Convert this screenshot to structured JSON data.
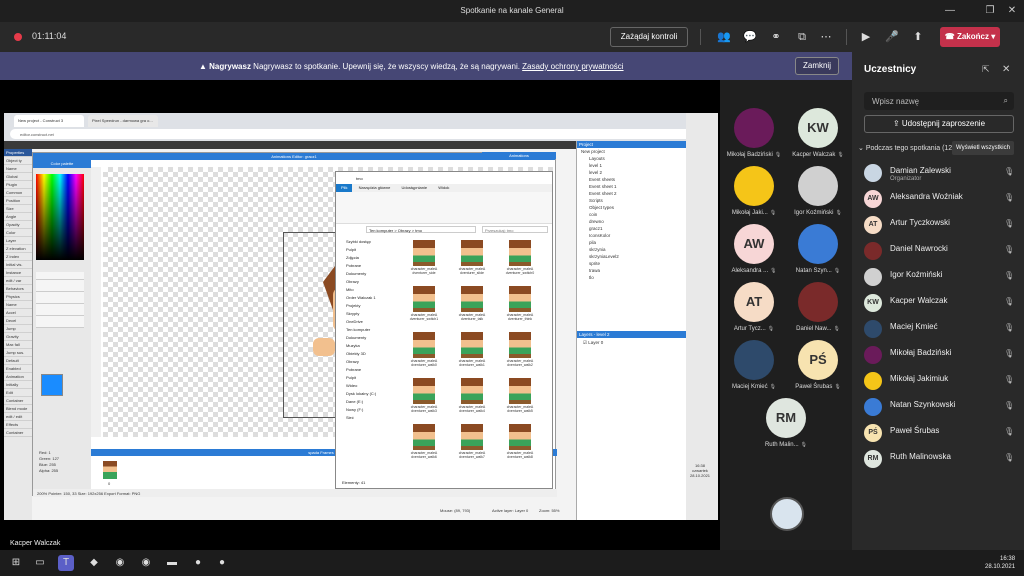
{
  "window": {
    "title": "Spotkanie na kanale General"
  },
  "toolbar": {
    "timer": "01:11:04",
    "control_label": "Zażądaj kontroli",
    "end_label": "Zakończ"
  },
  "banner": {
    "bold": "Nagrywasz",
    "text": " Nagrywasz to spotkanie. Upewnij się, że wszyscy wiedzą, że są nagrywani. ",
    "link": "Zasady ochrony prywatności",
    "close_label": "Zamknij"
  },
  "shared": {
    "presenter": "Kacper Walczak",
    "browser_tabs": [
      "New project - Construct 3",
      "Pixel Speedrun - darmowa gra o..."
    ],
    "url": "editor.construct.net",
    "properties": [
      "Properties",
      "Object ty",
      "Name",
      "Global",
      "Plugin",
      "Common",
      "Position",
      "Size",
      "Angle",
      "Opacity",
      "Color",
      "Layer",
      "Z elevation",
      "Z index",
      "Initial vis.",
      "Instance",
      "edit / var",
      "Behaviors",
      "Physics",
      "Name",
      "Accel",
      "Decel",
      "Jump",
      "Gravity",
      "Max fall",
      "Jump sus.",
      "Default",
      "Enabled",
      "Animation",
      "Initially",
      "Edit",
      "Container",
      "Blend mode",
      "edit / edit",
      "Effects",
      "Container"
    ],
    "anim_editor_title": "Animations Editor: gracz1",
    "animations_title": "Animations",
    "palette_title": "Color palette",
    "rgba": {
      "red": "Red: 1",
      "green": "Green: 127",
      "blue": "Blue: 255",
      "alpha": "Alpha: 255"
    },
    "frames_title": "spada Frames (1)",
    "frame_num": "0",
    "status": "200%     Pointer: 150, 33                                                    Size: 192x256   Export Format: PNG",
    "explorer": {
      "title": "tmo",
      "tabs": [
        "Plik",
        "Narzędzia główne",
        "Udostępnianie",
        "Widok"
      ],
      "address": "Ten komputer > Obrazy > tmo",
      "search": "Przeszukaj: tmo",
      "nav": [
        "Szybki dostęp",
        "Pulpit",
        "Zdjęcia",
        "Pobrane",
        "Dokumenty",
        "Obrazy",
        "Mito",
        "Order Walczak 1",
        "Projekty",
        "Skrypty",
        "OneDrive",
        "Ten komputer",
        "Dokumenty",
        "Muzyka",
        "Obiekty 3D",
        "Obrazy",
        "Pobrane",
        "Pulpit",
        "Wideo",
        "Dysk lokalny (C:)",
        "Dane (E:)",
        "Nowy (F:)",
        "Sieć"
      ],
      "files": [
        "character_maleA dventurer_side",
        "character_maleA dventurer_slide",
        "character_maleA dventurer_switch0",
        "character_maleA dventurer_switch1",
        "character_maleA dventurer_talk",
        "character_maleA dventurer_think",
        "character_maleA dventurer_walk0",
        "character_maleA dventurer_walk1",
        "character_maleA dventurer_walk2",
        "character_maleA dventurer_walk3",
        "character_maleA dventurer_walk4",
        "character_maleA dventurer_walk5",
        "character_maleA dventurer_walk6",
        "character_maleA dventurer_walk7",
        "character_maleA dventurer_walk8"
      ],
      "footer": "Elementy: 41"
    },
    "project_title": "Project",
    "project_items": [
      "New project",
      "Layouts",
      "level 1",
      "level 2",
      "Event sheets",
      "Event sheet 1",
      "Event sheet 2",
      "Scripts",
      "Object types",
      "coin",
      "drewno",
      "gracz1",
      "IconsKolor",
      "pila",
      "skrzynia",
      "skrzyniaLevel2",
      "sprite",
      "trawa",
      "tlo"
    ],
    "layers_title": "Layers - level 2",
    "layer0": "Layer 0",
    "mouse": "Mouse: (89, 793)",
    "active_layer": "Active layer: Layer 0",
    "zoom": "Zoom: 55%",
    "rp_time": "16:38",
    "rp_day": "czwartek",
    "rp_date": "28.10.2021"
  },
  "gallery": [
    {
      "name": "Mikołaj Badziński",
      "initials": "",
      "color": "#6a1b5a"
    },
    {
      "name": "Kacper Walczak",
      "initials": "KW",
      "color": "#dde8dc"
    },
    {
      "name": "Mikołaj Jaki...",
      "initials": "",
      "color": "#f5c518"
    },
    {
      "name": "Igor Koźmiński",
      "initials": "",
      "color": "#d0d0d0"
    },
    {
      "name": "Aleksandra ...",
      "initials": "AW",
      "color": "#f7d6d6"
    },
    {
      "name": "Natan Szyn...",
      "initials": "",
      "color": "#3a7bd5"
    },
    {
      "name": "Artur Tycz...",
      "initials": "AT",
      "color": "#f6dcc6"
    },
    {
      "name": "Daniel Naw...",
      "initials": "",
      "color": "#7a2a2a"
    },
    {
      "name": "Maciej Kmieć",
      "initials": "",
      "color": "#2e4a6b"
    },
    {
      "name": "Paweł Śrubas",
      "initials": "PŚ",
      "color": "#f7e3b0"
    },
    {
      "name": "Ruth Malin...",
      "initials": "RM",
      "color": "#dfe6df"
    }
  ],
  "participants": {
    "title": "Uczestnicy",
    "search_placeholder": "Wpisz nazwę",
    "invite_label": "Udostępnij zaproszenie",
    "section_label": "Podczas tego spotkania (12)",
    "show_all": "Wyświetl wszystkich",
    "list": [
      {
        "name": "Damian Zalewski",
        "sub": "Organizator",
        "initials": "",
        "color": "#c9d6e3"
      },
      {
        "name": "Aleksandra Woźniak",
        "sub": "",
        "initials": "AW",
        "color": "#f7d6d6"
      },
      {
        "name": "Artur Tyczkowski",
        "sub": "",
        "initials": "AT",
        "color": "#f6dcc6"
      },
      {
        "name": "Daniel Nawrocki",
        "sub": "",
        "initials": "",
        "color": "#7a2a2a"
      },
      {
        "name": "Igor Koźmiński",
        "sub": "",
        "initials": "",
        "color": "#d0d0d0"
      },
      {
        "name": "Kacper Walczak",
        "sub": "",
        "initials": "KW",
        "color": "#dde8dc"
      },
      {
        "name": "Maciej Kmieć",
        "sub": "",
        "initials": "",
        "color": "#2e4a6b"
      },
      {
        "name": "Mikołaj Badziński",
        "sub": "",
        "initials": "",
        "color": "#6a1b5a"
      },
      {
        "name": "Mikołaj Jakimiuk",
        "sub": "",
        "initials": "",
        "color": "#f5c518"
      },
      {
        "name": "Natan Szynkowski",
        "sub": "",
        "initials": "",
        "color": "#3a7bd5"
      },
      {
        "name": "Paweł Śrubas",
        "sub": "",
        "initials": "PŚ",
        "color": "#f7e3b0"
      },
      {
        "name": "Ruth Malinowska",
        "sub": "",
        "initials": "RM",
        "color": "#dfe6df"
      }
    ]
  },
  "taskbar": {
    "time": "16:38",
    "date": "28.10.2021"
  }
}
